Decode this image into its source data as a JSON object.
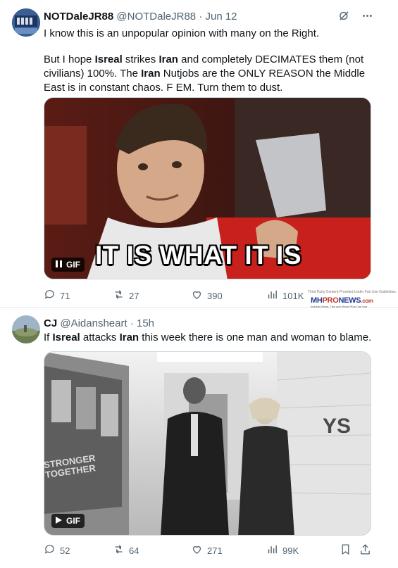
{
  "tweet1": {
    "name": "NOTDaleJR88",
    "handle": "@NOTDaleJR88 · Jun 12",
    "text_line1": "I know this is an unpopular opinion with many on the Right.",
    "para2": [
      {
        "t": "But I hope ",
        "b": false
      },
      {
        "t": "Isreal",
        "b": true
      },
      {
        "t": " strikes ",
        "b": false
      },
      {
        "t": "Iran",
        "b": true
      },
      {
        "t": " and completely DECIMATES them (not civilians) 100%. The ",
        "b": false
      },
      {
        "t": "Iran",
        "b": true
      },
      {
        "t": " Nutjobs are the ONLY REASON the Middle East is in constant chaos.  F EM. Turn them to dust.",
        "b": false
      }
    ],
    "gif_label": "GIF",
    "gif_caption": "IT IS WHAT IT IS",
    "replies": "71",
    "reposts": "27",
    "likes": "390",
    "views": "101K"
  },
  "tweet2": {
    "name": "CJ",
    "handle": "@Aidansheart · 15h",
    "text": [
      {
        "t": "If ",
        "b": false
      },
      {
        "t": "Isreal",
        "b": true
      },
      {
        "t": " attacks ",
        "b": false
      },
      {
        "t": "Iran",
        "b": true
      },
      {
        "t": " this week there is one man and woman to blame.",
        "b": false
      }
    ],
    "gif_label": "GIF",
    "sign_text": "STRONGER TOGETHER",
    "replies": "52",
    "reposts": "64",
    "likes": "271",
    "views": "99K"
  },
  "watermark": {
    "small_text": "Third Party Content Provided Under Fair Use Guidelines.",
    "logo_mh": "MH",
    "logo_pro": "PRO",
    "logo_news": "NEWS",
    "logo_com": ".com",
    "tagline": "Industry News, Tips and Views Pros Can Use"
  },
  "colors": {
    "text": "#0f1419",
    "muted": "#536471",
    "border": "#e6ecf0"
  },
  "icons": [
    "grok-icon",
    "more-icon",
    "reply-icon",
    "repost-icon",
    "like-icon",
    "views-icon",
    "bookmark-icon",
    "share-icon",
    "pause-icon",
    "play-icon"
  ]
}
